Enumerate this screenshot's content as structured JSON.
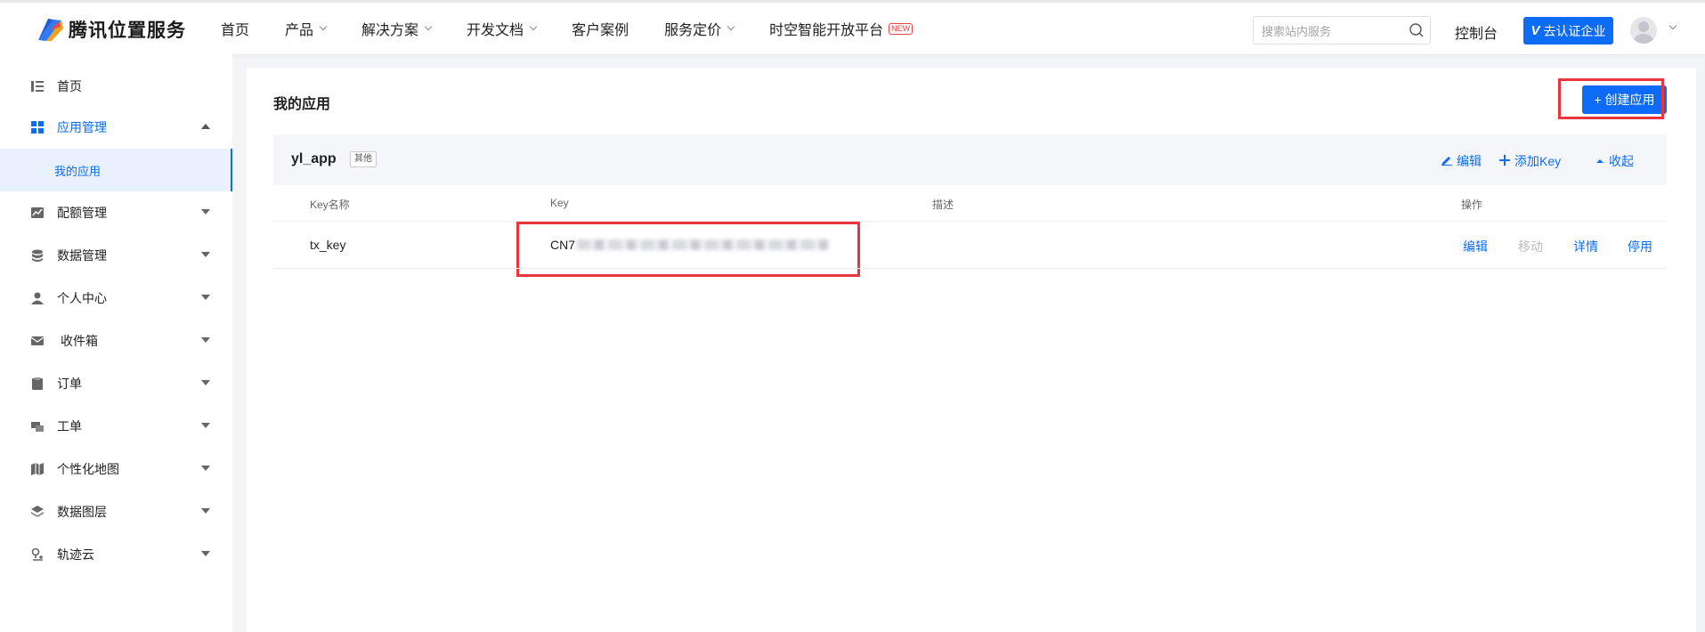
{
  "topbar": {
    "brand": "腾讯位置服务",
    "nav": [
      {
        "label": "首页",
        "dropdown": false
      },
      {
        "label": "产品",
        "dropdown": true
      },
      {
        "label": "解决方案",
        "dropdown": true
      },
      {
        "label": "开发文档",
        "dropdown": true
      },
      {
        "label": "客户案例",
        "dropdown": false
      },
      {
        "label": "服务定价",
        "dropdown": true
      },
      {
        "label": "时空智能开放平台",
        "dropdown": false
      }
    ],
    "new_badge": "NEW",
    "search_placeholder": "搜索站内服务",
    "console": "控制台",
    "verify_label": "去认证企业",
    "verify_mark": "V"
  },
  "sidebar": {
    "items": [
      {
        "label": "首页",
        "icon": "list-icon"
      },
      {
        "label": "应用管理",
        "icon": "grid-icon"
      },
      {
        "label": "配额管理",
        "icon": "chart-icon"
      },
      {
        "label": "数据管理",
        "icon": "database-icon"
      },
      {
        "label": "个人中心",
        "icon": "user-icon"
      },
      {
        "label": "收件箱",
        "icon": "mail-icon"
      },
      {
        "label": "订单",
        "icon": "clipboard-icon"
      },
      {
        "label": "工单",
        "icon": "ticket-icon"
      },
      {
        "label": "个性化地图",
        "icon": "map-icon"
      },
      {
        "label": "数据图层",
        "icon": "layers-icon"
      },
      {
        "label": "轨迹云",
        "icon": "track-icon"
      }
    ],
    "sub_item": "我的应用"
  },
  "main": {
    "title": "我的应用",
    "create_label": "+ 创建应用",
    "app": {
      "name": "yl_app",
      "tag": "其他",
      "actions": {
        "edit": "编辑",
        "add_key": "添加Key",
        "collapse": "收起"
      }
    },
    "columns": [
      "Key名称",
      "Key",
      "描述",
      "操作"
    ],
    "rows": [
      {
        "key_name": "tx_key",
        "key_prefix": "CN7",
        "description": "",
        "actions": {
          "edit": "编辑",
          "move": "移动",
          "detail": "详情",
          "disable": "停用"
        }
      }
    ]
  },
  "colors": {
    "accent": "#0c6cf5",
    "highlight": "#e8363c"
  }
}
